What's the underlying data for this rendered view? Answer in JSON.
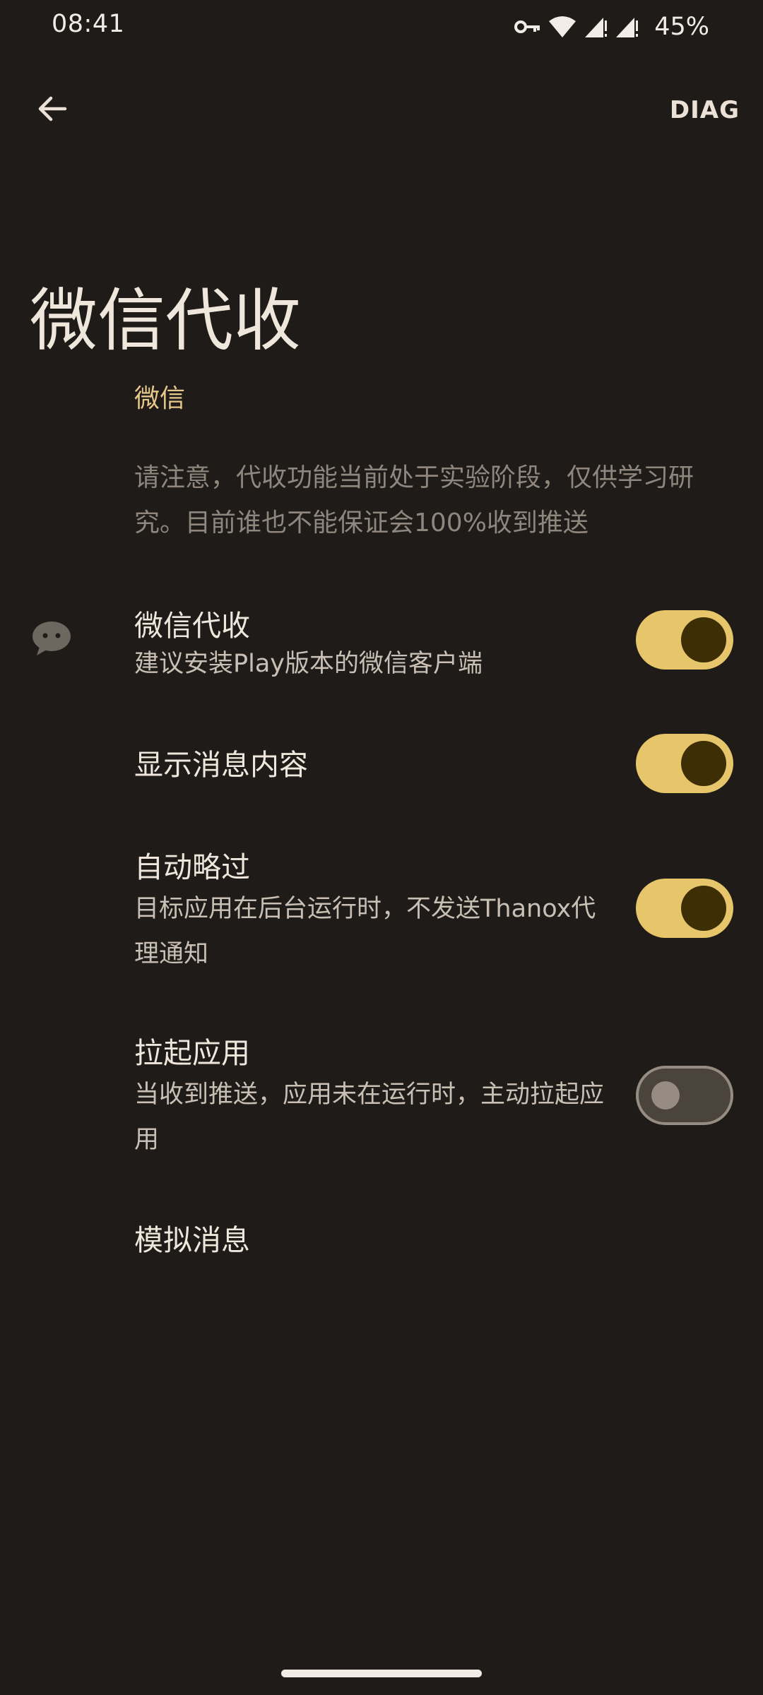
{
  "status_bar": {
    "time": "08:41",
    "battery": "45%",
    "icons": [
      "vpn-key-icon",
      "wifi-icon",
      "signal-icon",
      "signal-icon",
      "battery-icon"
    ]
  },
  "app_bar": {
    "back_icon": "arrow-back-icon",
    "action_label": "DIAG"
  },
  "page": {
    "title": "微信代收"
  },
  "category": {
    "header": "微信",
    "notice": "请注意，代收功能当前处于实验阶段，仅供学习研究。目前谁也不能保证会100%收到推送"
  },
  "preferences": [
    {
      "title": "微信代收",
      "summary": "建议安装Play版本的微信客户端",
      "icon": "wechat-icon",
      "switch": true
    },
    {
      "title": "显示消息内容",
      "summary": "",
      "switch": true
    },
    {
      "title": "自动略过",
      "summary": "目标应用在后台运行时，不发送Thanox代理通知",
      "switch": true
    },
    {
      "title": "拉起应用",
      "summary": "当收到推送，应用未在运行时，主动拉起应用",
      "switch": false
    },
    {
      "title": "模拟消息",
      "summary": ""
    }
  ],
  "colors": {
    "background": "#1e1b18",
    "accent": "#e6c56b",
    "category": "#e6c88a",
    "switch_thumb_on": "#3d2e05",
    "switch_off_border": "#968c81"
  }
}
